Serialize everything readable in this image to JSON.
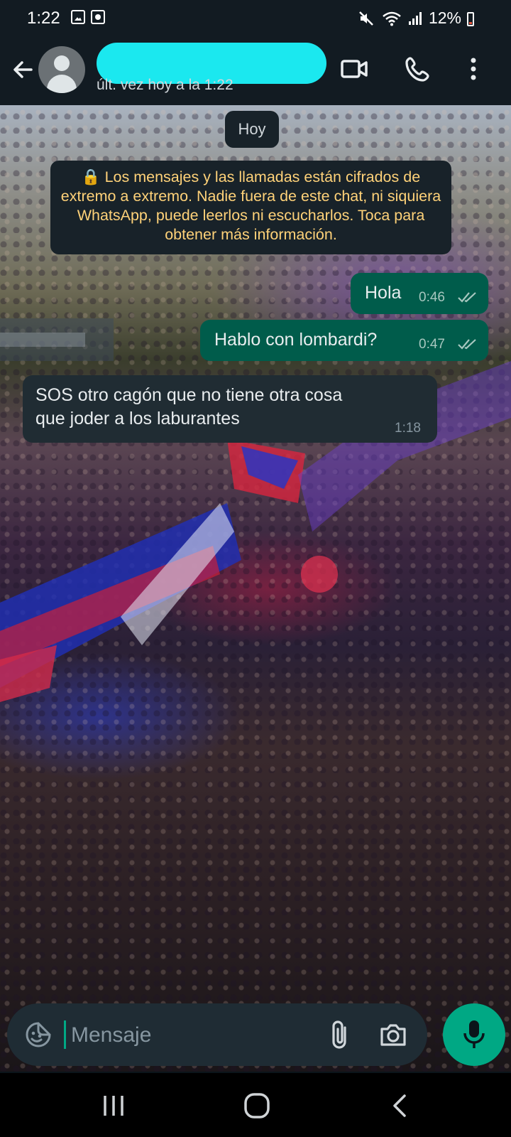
{
  "status_bar": {
    "time": "1:22",
    "battery": "12%"
  },
  "header": {
    "back_icon": "arrow-left-icon",
    "last_seen": "últ. vez hoy a la 1:22",
    "icons": [
      "video-call-icon",
      "phone-icon",
      "more-vert-icon"
    ],
    "redaction_color": "#1be8ef"
  },
  "chat": {
    "date_pill": "Hoy",
    "encryption_notice": "🔒 Los mensajes y las llamadas están cifrados de extremo a extremo. Nadie fuera de este chat, ni siquiera WhatsApp, puede leerlos ni escucharlos. Toca para obtener más información.",
    "messages": [
      {
        "direction": "outgoing",
        "text": "Hola",
        "time": "0:46",
        "status": "read"
      },
      {
        "direction": "outgoing",
        "text": "Hablo con lombardi?",
        "time": "0:47",
        "status": "read"
      },
      {
        "direction": "incoming",
        "text_line1": "SOS otro cagón que no tiene otra cosa",
        "text_line2": "que joder a los laburantes",
        "time": "1:18"
      }
    ]
  },
  "composer": {
    "placeholder": "Mensaje",
    "icons": [
      "emoji-sticker-icon",
      "attach-clip-icon",
      "camera-icon",
      "microphone-icon"
    ]
  },
  "nav": {
    "icons": [
      "recent-apps-icon",
      "home-icon",
      "back-icon"
    ]
  },
  "colors": {
    "outgoing_bubble": "#005c4b",
    "incoming_bubble": "#202c33",
    "accent": "#00a884",
    "notice_text": "#ffd279"
  }
}
